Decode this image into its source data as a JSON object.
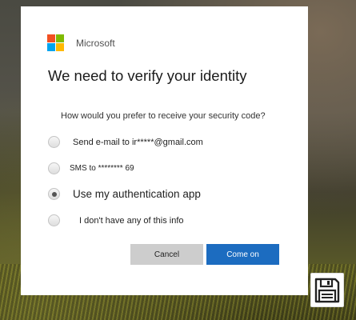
{
  "brand": {
    "name": "Microsoft",
    "logo_colors": [
      "#f25022",
      "#7fba00",
      "#00a4ef",
      "#ffb900"
    ]
  },
  "dialog": {
    "title": "We need to verify your identity",
    "question": "How would you prefer to receive your security code?",
    "options": [
      {
        "label": "Send e-mail to ir*****@gmail.com",
        "checked": false
      },
      {
        "label": "SMS to ******** 69",
        "checked": false
      },
      {
        "label": "Use my authentication app",
        "checked": true
      },
      {
        "label": "I don't have any of this info",
        "checked": false
      }
    ],
    "buttons": {
      "cancel": "Cancel",
      "confirm": "Come on"
    }
  },
  "colors": {
    "primary_button": "#1c6cc0",
    "secondary_button": "#cdcdcd"
  },
  "icons": {
    "corner": "floppy-disk-icon"
  }
}
